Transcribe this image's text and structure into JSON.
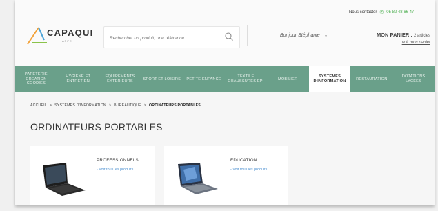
{
  "header": {
    "logo": {
      "name": "CAPAQUI",
      "tagline": "APPE"
    },
    "search": {
      "placeholder": "Rechercher un produit, une référence ..."
    },
    "greeting": "Bonjour Stéphanie",
    "contact": {
      "label": "Nous contacter",
      "phone": "05 82 48 66 47"
    },
    "cart": {
      "label": "MON PANIER :",
      "count": "2 articles",
      "link": "voir mon panier"
    }
  },
  "nav": {
    "items": [
      {
        "label": "PAPETERIE CRÉATION COODIES"
      },
      {
        "label": "HYGIÈNE ET ENTRETIEN"
      },
      {
        "label": "ÉQUIPEMENTS EXTÉRIEURS"
      },
      {
        "label": "SPORT ET LOISIRS"
      },
      {
        "label": "PETITE ENFANCE"
      },
      {
        "label": "TEXTILE CHAUSSURES EPI"
      },
      {
        "label": "MOBILIER"
      },
      {
        "label": "SYSTÈMES D'INFORMATION",
        "active": true
      },
      {
        "label": "RESTAURATION"
      },
      {
        "label": "DOTATIONS LYCÉES"
      }
    ]
  },
  "breadcrumb": {
    "items": [
      "ACCUEIL",
      "SYSTÈMES D'INFORMATION",
      "BUREAUTIQUE"
    ],
    "current": "ORDINATEURS PORTABLES",
    "separator": ">"
  },
  "main": {
    "title": "ORDINATEURS PORTABLES",
    "cards": [
      {
        "title": "PROFESSIONNELS",
        "link": "- Voir tous les produits"
      },
      {
        "title": "EDUCATION",
        "link": "- Voir tous les produits"
      }
    ]
  },
  "colors": {
    "nav_bg": "#6aa08a",
    "accent_green": "#4caf50",
    "link_blue": "#4a8fd0"
  }
}
